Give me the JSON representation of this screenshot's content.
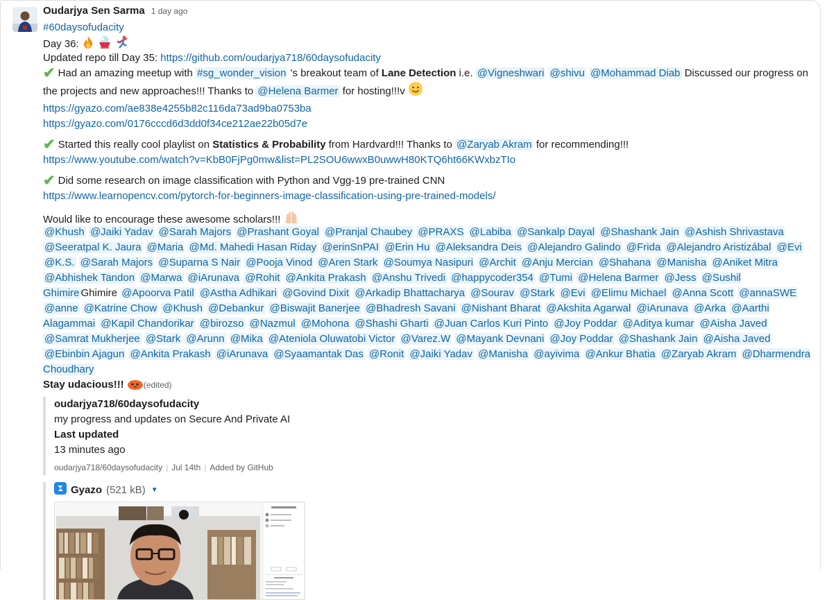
{
  "message": {
    "author": "Oudarjya Sen Sarma",
    "timestamp": "1 day ago",
    "channel_tag": "#60daysofudacity",
    "day_label": "Day 36:",
    "repo_prefix": "Updated repo till Day 35: ",
    "repo_url": "https://github.com/oudarjya718/60daysofudacity",
    "meetup_text_1": "Had an amazing meetup with ",
    "meetup_channel": "#sg_wonder_vision",
    "meetup_text_2": " 's breakout team of ",
    "meetup_bold": "Lane Detection",
    "meetup_text_3": " i.e. ",
    "meetup_mentions": [
      "@Vigneshwari",
      "@shivu",
      "@Mohammad Diab"
    ],
    "meetup_text_4": " Discussed our progress on the projects and new approaches!!! Thanks to ",
    "meetup_host": "@Helena Barmer",
    "meetup_text_5": " for hosting!!!v ",
    "gyazo_link_1": "https://gyazo.com/ae838e4255b82c116da73ad9ba0753ba",
    "gyazo_link_2": "https://gyazo.com/0176cccd6d3dd0f34ce212ae22b05d7e",
    "playlist_text_1": "Started this really cool playlist on ",
    "playlist_bold": "Statistics & Probability",
    "playlist_text_2": " from Hardvard!!! Thanks to ",
    "playlist_mention": "@Zaryab Akram",
    "playlist_text_3": " for recommending!!!",
    "youtube_link": "https://www.youtube.com/watch?v=KbB0FjPg0mw&list=PL2SOU6wwxB0uwwH80KTQ6ht66KWxbzTIo",
    "research_text": "Did some research on image classification with Python and Vgg-19 pre-trained CNN",
    "research_link": "https://www.learnopencv.com/pytorch-for-beginners-image-classification-using-pre-trained-models/",
    "encourage_text": "Would like to encourage these awesome scholars!!! ",
    "scholars": [
      "@Khush",
      "@Jaiki Yadav",
      "@Sarah Majors",
      "@Prashant Goyal",
      "@Pranjal Chaubey",
      "@PRAXS",
      "@Labiba",
      "@Sankalp Dayal",
      "@Shashank Jain",
      "@Ashish Shrivastava",
      "@Seeratpal K. Jaura",
      "@Maria",
      "@Md. Mahedi Hasan Riday",
      "@erinSnPAI",
      "@Erin Hu",
      "@Aleksandra Deis",
      "@Alejandro Galindo",
      "@Frida",
      "@Alejandro Aristizábal",
      "@Evi",
      "@K.S.",
      "@Sarah Majors",
      "@Suparna S Nair",
      "@Pooja Vinod",
      "@Aren Stark",
      "@Soumya Nasipuri",
      "@Archit",
      "@Anju Mercian",
      "@Shahana",
      "@Manisha",
      "@Aniket Mitra",
      "@Abhishek Tandon",
      "@Marwa",
      "@iArunava",
      "@Rohit",
      "@Ankita Prakash",
      "@Anshu Trivedi",
      "@happycoder354",
      "@Tumi",
      "@Helena Barmer",
      "@Jess",
      "@Sushil Ghimire",
      "@Apoorva Patil",
      "@Astha Adhikari",
      "@Govind Dixit",
      "@Arkadip Bhattacharya",
      "@Sourav",
      "@Stark",
      "@Evi",
      "@Elimu Michael",
      "@Anna Scott",
      "@annaSWE",
      "@anne",
      "@Katrine Chow",
      "@Khush",
      "@Debankur",
      "@Biswajit Banerjee",
      "@Bhadresh Savani",
      "@Nishant Bharat",
      "@Akshita Agarwal",
      "@iArunava",
      "@Arka",
      "@Aarthi Alagammai",
      "@Kapil Chandorikar",
      "@birozso",
      "@Nazmul",
      "@Mohona",
      "@Shashi Gharti",
      "@Juan Carlos Kuri Pinto",
      "@Joy Poddar",
      "@Aditya kumar",
      "@Aisha Javed",
      "@Samrat Mukherjee",
      "@Stark",
      "@Arunn",
      "@Mika",
      "@Ateniola Oluwatobi Victor",
      "@Varez.W",
      "@Mayank Devnani",
      "@Joy Poddar",
      "@Shashank Jain",
      "@Aisha Javed",
      "@Ebinbin Ajagun",
      "@Ankita Prakash",
      "@iArunava",
      "@Syaamantak Das",
      "@Ronit",
      "@Jaiki Yadav",
      "@Manisha",
      "@ayivima",
      "@Ankur Bhatia",
      "@Zaryab Akram",
      "@Dharmendra Choudhary"
    ],
    "extra_plain_after_sushil": "Ghimire",
    "closing": "Stay udacious!!!",
    "edited": "(edited)"
  },
  "github_attachment": {
    "title": "oudarjya718/60daysofudacity",
    "description": "my progress and updates on Secure And Private AI",
    "field_label": "Last updated",
    "field_value": "13 minutes ago",
    "footer_repo": "oudarjya718/60daysofudacity",
    "footer_date": "Jul 14th",
    "footer_source": "Added by GitHub"
  },
  "gyazo_attachment": {
    "name": "Gyazo",
    "size": "(521 kB)"
  },
  "colors": {
    "link": "#1264a3",
    "mention_bg": "#e8f5fa",
    "check_green": "#5bb84b",
    "meta_gray": "#616061"
  },
  "icons": [
    "fire-icon",
    "shaved-ice-icon",
    "athlete-icon",
    "check-icon",
    "slightly-smiling-face-icon",
    "raised-hands-icon",
    "udacity-blob-icon",
    "gyazo-logo-icon",
    "chevron-down-icon"
  ]
}
